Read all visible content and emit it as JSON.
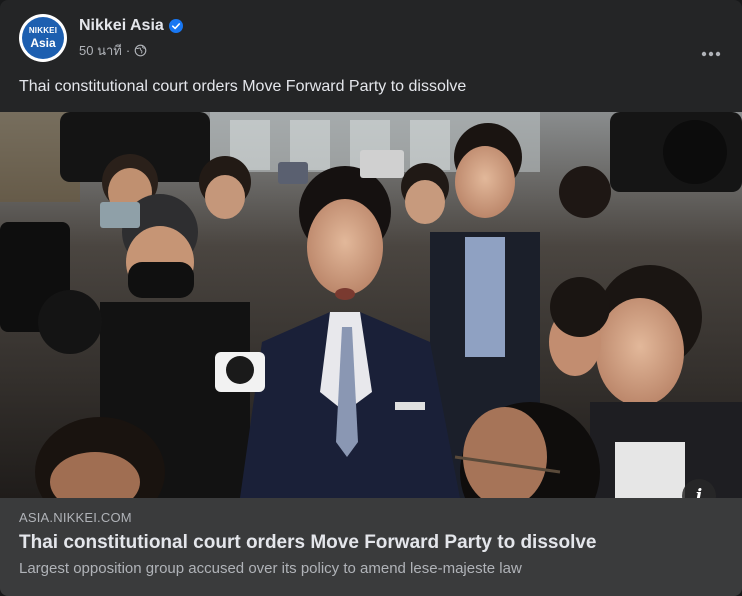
{
  "post": {
    "avatar_top": "NIKKEI",
    "avatar_bottom": "Asia",
    "page_name": "Nikkei Asia",
    "timestamp": "50 นาที",
    "separator": "·",
    "visibility_icon": "globe-icon",
    "more_icon": "more-horizontal-icon",
    "text": "Thai constitutional court orders Move Forward Party to dissolve"
  },
  "link_preview": {
    "domain": "ASIA.NIKKEI.COM",
    "title": "Thai constitutional court orders Move Forward Party to dissolve",
    "description": "Largest opposition group accused over its policy to amend lese-majeste law",
    "info_label": "i"
  },
  "colors": {
    "card_bg": "#242526",
    "preview_bg": "#3a3b3c",
    "primary_text": "#e4e6eb",
    "secondary_text": "#b0b3b8",
    "verified_blue": "#1877f2",
    "avatar_blue": "#1d5fb0"
  }
}
